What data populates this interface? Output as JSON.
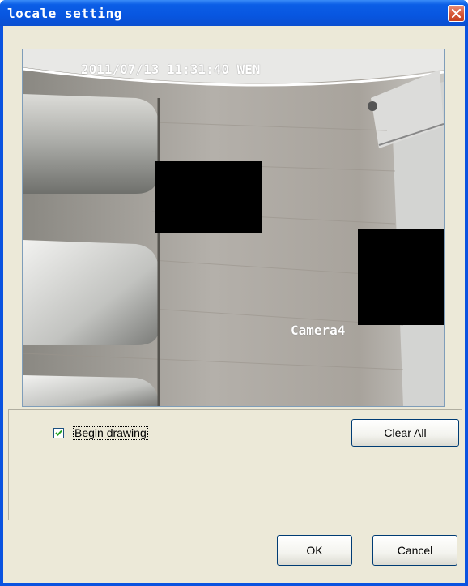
{
  "window": {
    "title": "locale setting",
    "close_icon": "close-icon"
  },
  "video": {
    "timestamp": "2011/07/13 11:31:40 WEN",
    "camera_label": "Camera4",
    "mask_color": "#000000"
  },
  "controls": {
    "begin_drawing_label": "Begin drawing",
    "begin_drawing_checked": true,
    "clear_all_label": "Clear All",
    "ok_label": "OK",
    "cancel_label": "Cancel"
  },
  "colors": {
    "titlebar": "#0856e0",
    "dialog_bg": "#ece9d8",
    "close_button": "#d85a3a"
  }
}
